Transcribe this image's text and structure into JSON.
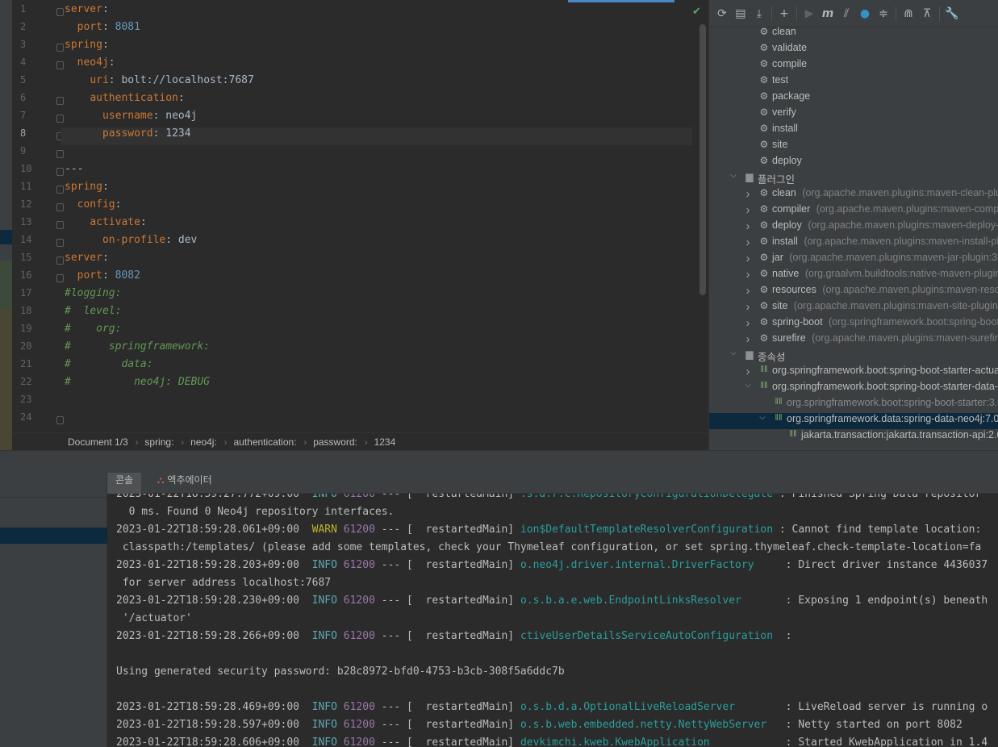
{
  "editor": {
    "lines": [
      {
        "num": "1",
        "parts": [
          {
            "t": "server",
            "c": "k"
          },
          {
            "t": ":",
            "c": "v"
          }
        ]
      },
      {
        "num": "2",
        "parts": [
          {
            "t": "  "
          },
          {
            "t": "port",
            "c": "k"
          },
          {
            "t": ": ",
            "c": "v"
          },
          {
            "t": "8081",
            "c": "n"
          }
        ]
      },
      {
        "num": "3",
        "parts": [
          {
            "t": "spring",
            "c": "k"
          },
          {
            "t": ":",
            "c": "v"
          }
        ]
      },
      {
        "num": "4",
        "parts": [
          {
            "t": "  "
          },
          {
            "t": "neo4j",
            "c": "k"
          },
          {
            "t": ":",
            "c": "v"
          }
        ]
      },
      {
        "num": "5",
        "parts": [
          {
            "t": "    "
          },
          {
            "t": "uri",
            "c": "k"
          },
          {
            "t": ": bolt://localhost:7687",
            "c": "v"
          }
        ]
      },
      {
        "num": "6",
        "parts": [
          {
            "t": "    "
          },
          {
            "t": "authentication",
            "c": "k"
          },
          {
            "t": ":",
            "c": "v"
          }
        ]
      },
      {
        "num": "7",
        "parts": [
          {
            "t": "      "
          },
          {
            "t": "username",
            "c": "k"
          },
          {
            "t": ": neo4j",
            "c": "v"
          }
        ]
      },
      {
        "num": "8",
        "parts": [
          {
            "t": "      "
          },
          {
            "t": "password",
            "c": "k"
          },
          {
            "t": ": 1234",
            "c": "v"
          }
        ],
        "current": true
      },
      {
        "num": "9",
        "parts": []
      },
      {
        "num": "10",
        "parts": [
          {
            "t": "---",
            "c": "v"
          }
        ]
      },
      {
        "num": "11",
        "parts": [
          {
            "t": "spring",
            "c": "k"
          },
          {
            "t": ":",
            "c": "v"
          }
        ]
      },
      {
        "num": "12",
        "parts": [
          {
            "t": "  "
          },
          {
            "t": "config",
            "c": "k"
          },
          {
            "t": ":",
            "c": "v"
          }
        ]
      },
      {
        "num": "13",
        "parts": [
          {
            "t": "    "
          },
          {
            "t": "activate",
            "c": "k"
          },
          {
            "t": ":",
            "c": "v"
          }
        ]
      },
      {
        "num": "14",
        "parts": [
          {
            "t": "      "
          },
          {
            "t": "on-profile",
            "c": "k"
          },
          {
            "t": ": dev",
            "c": "v"
          }
        ]
      },
      {
        "num": "15",
        "parts": [
          {
            "t": "server",
            "c": "k"
          },
          {
            "t": ":",
            "c": "v"
          }
        ]
      },
      {
        "num": "16",
        "parts": [
          {
            "t": "  "
          },
          {
            "t": "port",
            "c": "k"
          },
          {
            "t": ": ",
            "c": "v"
          },
          {
            "t": "8082",
            "c": "n"
          }
        ]
      },
      {
        "num": "17",
        "parts": [
          {
            "t": "#logging:",
            "c": "c"
          }
        ]
      },
      {
        "num": "18",
        "parts": [
          {
            "t": "#  level:",
            "c": "c"
          }
        ]
      },
      {
        "num": "19",
        "parts": [
          {
            "t": "#    org:",
            "c": "c"
          }
        ]
      },
      {
        "num": "20",
        "parts": [
          {
            "t": "#      springframework:",
            "c": "c"
          }
        ]
      },
      {
        "num": "21",
        "parts": [
          {
            "t": "#        data:",
            "c": "c"
          }
        ]
      },
      {
        "num": "22",
        "parts": [
          {
            "t": "#          neo4j: DEBUG",
            "c": "c"
          }
        ]
      },
      {
        "num": "23",
        "parts": []
      },
      {
        "num": "24",
        "parts": []
      }
    ],
    "breadcrumb": [
      "Document 1/3",
      "spring:",
      "neo4j:",
      "authentication:",
      "password:",
      "1234"
    ]
  },
  "maven": {
    "lifecycle": [
      "clean",
      "validate",
      "compile",
      "test",
      "package",
      "verify",
      "install",
      "site",
      "deploy"
    ],
    "plugins_label": "플러그인",
    "plugins": [
      {
        "name": "clean",
        "coord": "(org.apache.maven.plugins:maven-clean-plugi"
      },
      {
        "name": "compiler",
        "coord": "(org.apache.maven.plugins:maven-compile"
      },
      {
        "name": "deploy",
        "coord": "(org.apache.maven.plugins:maven-deploy-pl"
      },
      {
        "name": "install",
        "coord": "(org.apache.maven.plugins:maven-install-plug"
      },
      {
        "name": "jar",
        "coord": "(org.apache.maven.plugins:maven-jar-plugin:3.3."
      },
      {
        "name": "native",
        "coord": "(org.graalvm.buildtools:native-maven-plugin:("
      },
      {
        "name": "resources",
        "coord": "(org.apache.maven.plugins:maven-resourc"
      },
      {
        "name": "site",
        "coord": "(org.apache.maven.plugins:maven-site-plugin:3."
      },
      {
        "name": "spring-boot",
        "coord": "(org.springframework.boot:spring-boot-"
      },
      {
        "name": "surefire",
        "coord": "(org.apache.maven.plugins:maven-surefire-p"
      }
    ],
    "deps_label": "종속성",
    "deps": [
      {
        "name": "org.springframework.boot:spring-boot-starter-actuat",
        "level": 1,
        "arrow": "right"
      },
      {
        "name": "org.springframework.boot:spring-boot-starter-data-n",
        "level": 1,
        "arrow": "down"
      },
      {
        "name": "org.springframework.boot:spring-boot-starter:3.0.",
        "level": 2,
        "arrow": "",
        "dim": true
      },
      {
        "name": "org.springframework.data:spring-data-neo4j:7.0.0",
        "level": 2,
        "arrow": "down",
        "selected": true
      },
      {
        "name": "jakarta.transaction:jakarta.transaction-api:2.0.1",
        "level": 3,
        "arrow": ""
      }
    ]
  },
  "bottom": {
    "tabs": [
      {
        "label": "콘솔",
        "icon": ""
      },
      {
        "label": "액추에이터",
        "icon": "actuator-icon"
      }
    ],
    "console": [
      {
        "ts": "2023-01-22T18:59:27.772+09:00",
        "level": "INFO",
        "pid": "61200",
        "thread": "--- [  restartedMain]",
        "logger": ".s.d.r.c.RepositoryConfigurationDelegate",
        "msg": ": Finished Spring Data repositor",
        "first": true
      },
      {
        "plain": "  0 ms. Found 0 Neo4j repository interfaces."
      },
      {
        "ts": "2023-01-22T18:59:28.061+09:00",
        "level": "WARN",
        "pid": "61200",
        "thread": "--- [  restartedMain]",
        "logger": "ion$DefaultTemplateResolverConfiguration",
        "msg": ": Cannot find template location:"
      },
      {
        "plain": " classpath:/templates/ (please add some templates, check your Thymeleaf configuration, or set spring.thymeleaf.check-template-location=fa"
      },
      {
        "ts": "2023-01-22T18:59:28.203+09:00",
        "level": "INFO",
        "pid": "61200",
        "thread": "--- [  restartedMain]",
        "logger": "o.neo4j.driver.internal.DriverFactory   ",
        "msg": " : Direct driver instance 4436037"
      },
      {
        "plain": " for server address localhost:7687"
      },
      {
        "ts": "2023-01-22T18:59:28.230+09:00",
        "level": "INFO",
        "pid": "61200",
        "thread": "--- [  restartedMain]",
        "logger": "o.s.b.a.e.web.EndpointLinksResolver     ",
        "msg": " : Exposing 1 endpoint(s) beneath"
      },
      {
        "plain": " '/actuator'"
      },
      {
        "ts": "2023-01-22T18:59:28.266+09:00",
        "level": "INFO",
        "pid": "61200",
        "thread": "--- [  restartedMain]",
        "logger": "ctiveUserDetailsServiceAutoConfiguration",
        "msg": " :"
      },
      {
        "plain": ""
      },
      {
        "plain": "Using generated security password: b28c8972-bfd0-4753-b3cb-308f5a6ddc7b"
      },
      {
        "plain": ""
      },
      {
        "ts": "2023-01-22T18:59:28.469+09:00",
        "level": "INFO",
        "pid": "61200",
        "thread": "--- [  restartedMain]",
        "logger": "o.s.b.d.a.OptionalLiveReloadServer      ",
        "msg": " : LiveReload server is running o"
      },
      {
        "ts": "2023-01-22T18:59:28.597+09:00",
        "level": "INFO",
        "pid": "61200",
        "thread": "--- [  restartedMain]",
        "logger": "o.s.b.web.embedded.netty.NettyWebServer ",
        "msg": " : Netty started on port 8082"
      },
      {
        "ts": "2023-01-22T18:59:28.606+09:00",
        "level": "INFO",
        "pid": "61200",
        "thread": "--- [  restartedMain]",
        "logger": "devkimchi.kweb.KwebApplication          ",
        "msg": " : Started KwebApplication in 1.4"
      }
    ]
  }
}
